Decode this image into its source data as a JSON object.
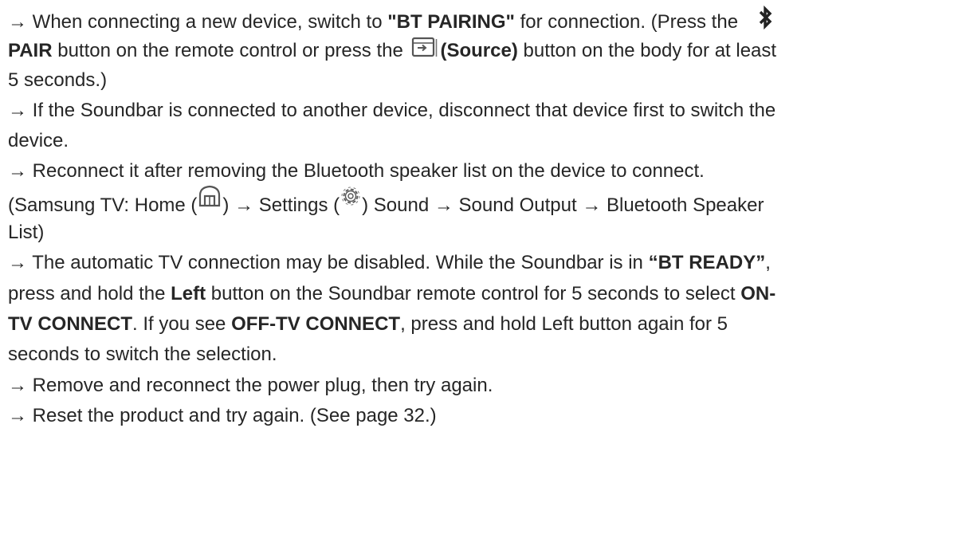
{
  "items": [
    {
      "arrow": "→",
      "p1": "When connecting a new device, switch to ",
      "b1": "\"BT PAIRING\"",
      "p2": " for connection. (Press the ",
      "bt_icon": "bluetooth-icon",
      "b2": "PAIR",
      "p3": " button on the remote control or press the ",
      "source_icon": "source-icon",
      "b3": "(Source)",
      "p4": " button on the body for at least",
      "p5": "5 seconds.)"
    },
    {
      "arrow": "→",
      "p1": "If the Soundbar is connected to another device, disconnect that device first to switch the",
      "p2": "device."
    },
    {
      "arrow": "→",
      "p1": "Reconnect it after removing the Bluetooth speaker list on the device to connect.",
      "p2": "(Samsung TV: Home (",
      "home_icon": "home-icon",
      "p3": ") → Settings (",
      "gear_icon": "gear-icon",
      "p4": ") Sound → Sound Output → Bluetooth Speaker",
      "p5": "List)"
    },
    {
      "arrow": "→",
      "p1": "The automatic TV connection may be disabled. While the Soundbar is in ",
      "b1": "“BT READY”",
      "p2": ",",
      "p3": "press and hold the ",
      "b2": "Left",
      "p4": " button on the Soundbar remote control for 5 seconds to select ",
      "b3": "ON-",
      "b4": "TV CONNECT",
      "p5": ". If you see ",
      "b5": "OFF-TV CONNECT",
      "p6": ", press and hold Left button again for 5",
      "p7": "seconds to switch the selection."
    },
    {
      "arrow": "→",
      "p1": "Remove and reconnect the power plug, then try again."
    },
    {
      "arrow": "→",
      "p1": "Reset the product and try again. (See page 32.)"
    }
  ]
}
